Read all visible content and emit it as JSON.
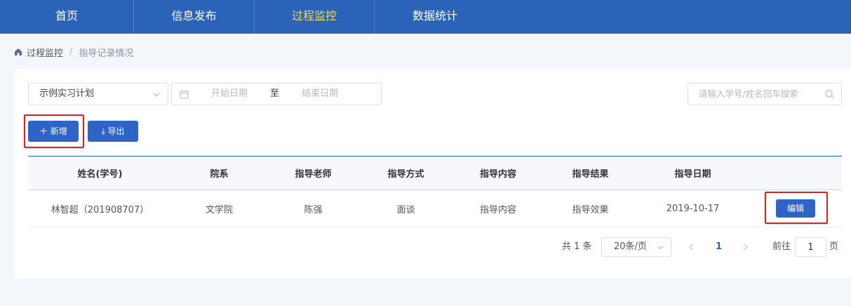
{
  "nav": {
    "items": [
      {
        "label": "首页",
        "active": false
      },
      {
        "label": "信息发布",
        "active": false
      },
      {
        "label": "过程监控",
        "active": true
      },
      {
        "label": "数据统计",
        "active": false
      }
    ],
    "active_color": "#ffd84a",
    "bg_color": "#2b63b8"
  },
  "breadcrumb": {
    "home_icon": "home-icon",
    "root": "过程监控",
    "separator": "/",
    "current": "指导记录情况"
  },
  "filters": {
    "plan_select": "示例实习计划",
    "start_date_placeholder": "开始日期",
    "range_separator": "至",
    "end_date_placeholder": "结束日期",
    "search_placeholder": "请输入学号/姓名回车搜索"
  },
  "toolbar": {
    "add_label": "＋ 新增",
    "export_label": "⤓ 导出"
  },
  "table": {
    "columns": [
      "姓名(学号)",
      "院系",
      "指导老师",
      "指导方式",
      "指导内容",
      "指导结果",
      "指导日期",
      ""
    ],
    "rows": [
      {
        "name": "林智超（201908707）",
        "dept": "文学院",
        "teacher": "陈强",
        "method": "面谈",
        "content": "指导内容",
        "result": "指导效果",
        "date": "2019-10-17",
        "action": "编辑"
      }
    ]
  },
  "pagination": {
    "total_text": "共 1 条",
    "page_size": "20条/页",
    "current_page": "1",
    "goto_label": "前往",
    "goto_value": "1",
    "page_unit": "页"
  },
  "colors": {
    "primary": "#2f63c6",
    "highlight": "#e02020"
  }
}
